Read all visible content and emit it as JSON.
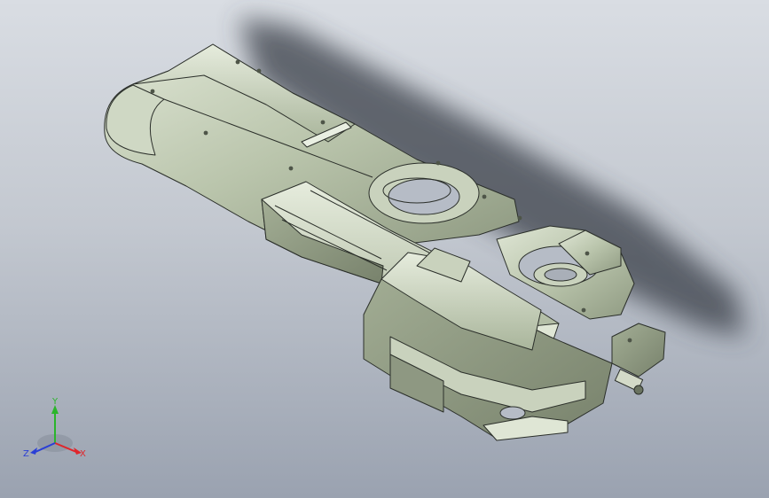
{
  "viewport": {
    "background_top": "#d9dde3",
    "background_bottom": "#9aa2b0",
    "model_fill": "#b9c4ab",
    "model_edge": "#2b2f2a",
    "shadow_color": "#3a3f48"
  },
  "triad": {
    "x_label": "X",
    "y_label": "Y",
    "z_label": "Z",
    "x_color": "#e0262b",
    "y_color": "#2bb52b",
    "z_color": "#2a3fd6"
  }
}
